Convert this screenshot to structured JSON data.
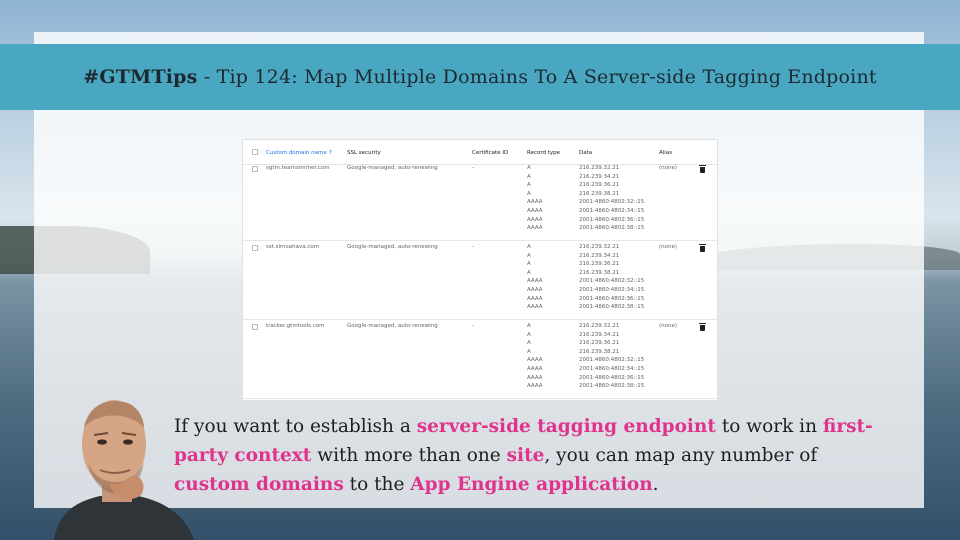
{
  "banner": {
    "hashtag": "#GTMTips",
    "rest": " - Tip 124: Map Multiple Domains To A Server-side Tagging Endpoint"
  },
  "table": {
    "headers": {
      "domain": "Custom domain name ↑",
      "ssl": "SSL security",
      "cert": "Certificate ID",
      "type": "Record type",
      "data": "Data",
      "alias": "Alias"
    },
    "rows": [
      {
        "domain": "sgtm.teamsimmer.com",
        "ssl": "Google-managed, auto-renewing",
        "cert": "-",
        "alias": "(none)",
        "types": "A\nA\nA\nA\nAAAA\nAAAA\nAAAA\nAAAA",
        "data": "216.239.32.21\n216.239.34.21\n216.239.36.21\n216.239.38.21\n2001:4860:4802:32::15\n2001:4860:4802:34::15\n2001:4860:4802:36::15\n2001:4860:4802:38::15"
      },
      {
        "domain": "sst.simoahava.com",
        "ssl": "Google-managed, auto-renewing",
        "cert": "-",
        "alias": "(none)",
        "types": "A\nA\nA\nA\nAAAA\nAAAA\nAAAA\nAAAA",
        "data": "216.239.32.21\n216.239.34.21\n216.239.36.21\n216.239.38.21\n2001:4860:4802:32::15\n2001:4860:4802:34::15\n2001:4860:4802:36::15\n2001:4860:4802:38::15"
      },
      {
        "domain": "tracker.gtmtools.com",
        "ssl": "Google-managed, auto-renewing",
        "cert": "-",
        "alias": "(none)",
        "types": "A\nA\nA\nA\nAAAA\nAAAA\nAAAA\nAAAA",
        "data": "216.239.32.21\n216.239.34.21\n216.239.36.21\n216.239.38.21\n2001:4860:4802:32::15\n2001:4860:4802:34::15\n2001:4860:4802:36::15\n2001:4860:4802:38::15"
      }
    ]
  },
  "caption": {
    "t1": "If you want to establish a ",
    "h1": "server-side tagging endpoint",
    "t2": " to work in ",
    "h2": "first-party context",
    "t3": " with more than one ",
    "h3": "site",
    "t4": ", you can map any number of ",
    "h4": "custom domains",
    "t5": " to the ",
    "h5": "App Engine application",
    "t6": "."
  },
  "colors": {
    "banner": "#4aa7c2",
    "highlight": "#e0338c",
    "sorted_header": "#1a73e8"
  },
  "icons": {
    "row_action": "trash-icon",
    "presenter": "avatar"
  }
}
